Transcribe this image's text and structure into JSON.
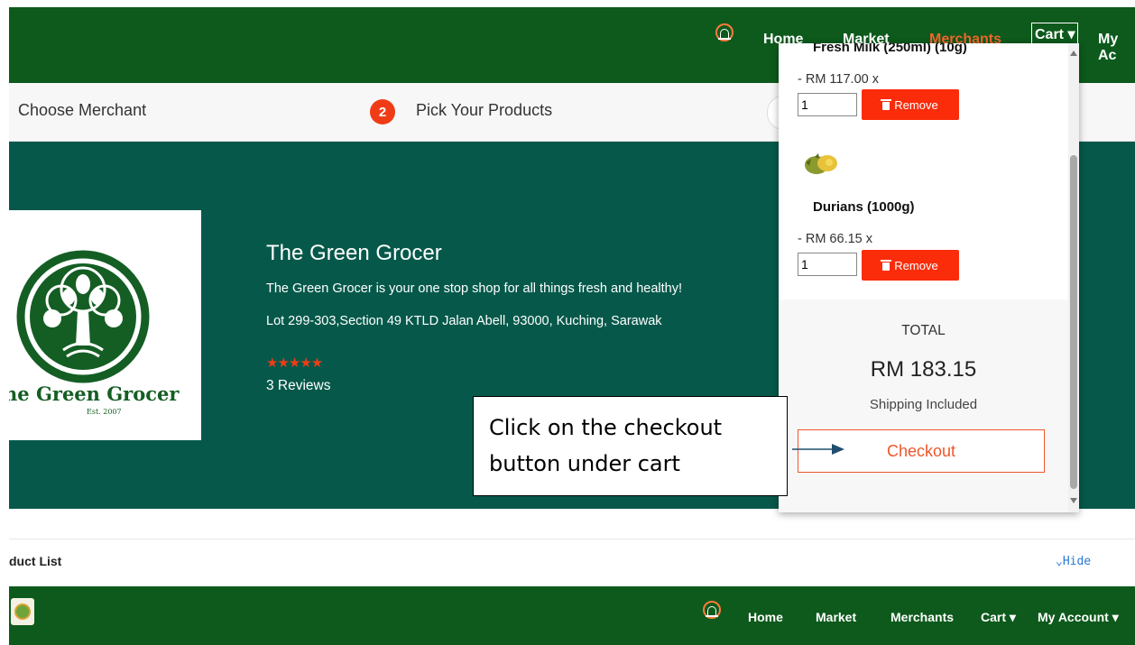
{
  "topnav": {
    "links": [
      "Home",
      "Market",
      "Merchants",
      "Cart ▾",
      "My Ac"
    ],
    "active_color": "#f0662a"
  },
  "steps": {
    "step1_label": "Choose Merchant",
    "step2_number": "2",
    "step2_label": "Pick Your Products"
  },
  "store": {
    "logo_text": "he Green Grocer",
    "logo_sub": "Est. 2007",
    "name": "The Green Grocer",
    "description": "The Green Grocer is your one stop shop for all things fresh and healthy!",
    "address": "Lot 299-303,Section 49 KTLD Jalan Abell, 93000, Kuching, Sarawak",
    "rating_stars": 5,
    "stars_text": "★★★★★",
    "reviews": "3 Reviews"
  },
  "product_list": {
    "title": "duct List",
    "hide_label": "Hide"
  },
  "bottomnav": {
    "links": [
      "Home",
      "Market",
      "Merchants",
      "Cart ▾",
      "My Account ▾"
    ]
  },
  "cart": {
    "items": [
      {
        "name": "Fresh Milk (250ml) (10g)",
        "price": "- RM 117.00 x",
        "qty": "1",
        "remove_label": "Remove"
      },
      {
        "name": "Durians (1000g)",
        "price": "- RM 66.15 x",
        "qty": "1",
        "remove_label": "Remove"
      }
    ],
    "total_label": "TOTAL",
    "total_amount": "RM 183.15",
    "shipping_note": "Shipping Included",
    "checkout_label": "Checkout"
  },
  "annotation": {
    "text": "Click on the checkout button under cart"
  },
  "colors": {
    "nav_green": "#0d5a1c",
    "hero_teal": "#06594a",
    "accent_red": "#fb2c0a",
    "checkout_orange": "#f0562c"
  }
}
